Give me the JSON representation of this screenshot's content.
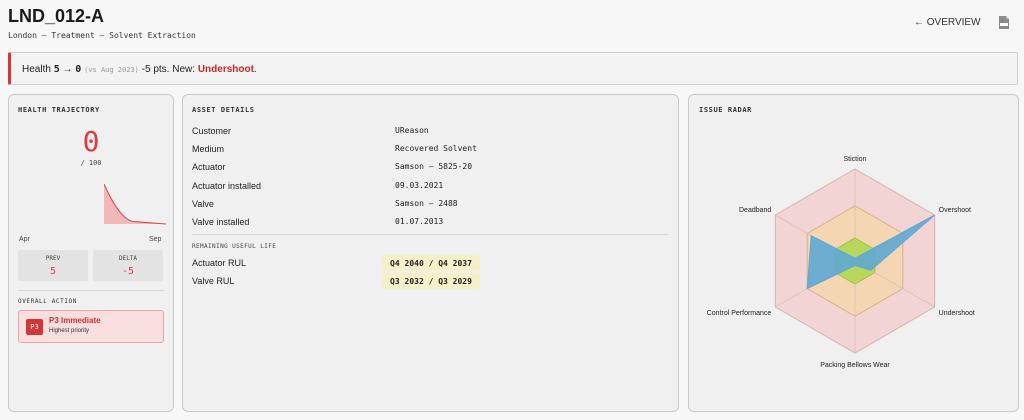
{
  "header": {
    "title": "LND_012-A",
    "subtitle": "London — Treatment — Solvent Extraction",
    "overview_link": "← OVERVIEW",
    "pdf_icon": "pdf-icon"
  },
  "alert": {
    "prefix": "Health",
    "from": "5",
    "arrow": "→",
    "to": "0",
    "comparison": "(vs Aug 2023)",
    "change": "-5 pts. New:",
    "issue": "Undershoot",
    "end": ".",
    "accent_color": "#d33333"
  },
  "health": {
    "heading": "HEALTH TRAJECTORY",
    "score": "0",
    "max": "/ 100",
    "trend": [
      5,
      0.3,
      0
    ],
    "axis_start": "Apr",
    "axis_end": "Sep",
    "prev_label": "PREV",
    "prev_value": "5",
    "delta_label": "DELTA",
    "delta_value": "-5",
    "action_heading": "OVERALL ACTION",
    "action_badge": "P3",
    "action_title": "P3 Immediate",
    "action_sub": "Highest priority"
  },
  "asset": {
    "heading": "ASSET DETAILS",
    "rows": [
      {
        "key": "Customer",
        "value": "UReason"
      },
      {
        "key": "Medium",
        "value": "Recovered Solvent"
      },
      {
        "key": "Actuator",
        "value": "Samson — 5825-20"
      },
      {
        "key": "Actuator installed",
        "value": "09.03.2021"
      },
      {
        "key": "Valve",
        "value": "Samson — 2488"
      },
      {
        "key": "Valve installed",
        "value": "01.07.2013"
      }
    ],
    "rul_heading": "REMAINING USEFUL LIFE",
    "rul": [
      {
        "key": "Actuator RUL",
        "value": "Q4 2040 / Q4 2037"
      },
      {
        "key": "Valve RUL",
        "value": "Q3 2032 / Q3 2029"
      }
    ]
  },
  "radar": {
    "heading": "ISSUE RADAR",
    "axes": [
      "Stiction",
      "Overshoot",
      "Undershoot",
      "Packing Bellows Wear",
      "Control Performance",
      "Deadband"
    ],
    "series_values": [
      0.03,
      1.0,
      0.2,
      0.05,
      0.6,
      0.55
    ],
    "series_color": "#5fa8d3",
    "band_colors": [
      "#f2d4d4",
      "#f4d6b2",
      "#b7d95a"
    ]
  }
}
